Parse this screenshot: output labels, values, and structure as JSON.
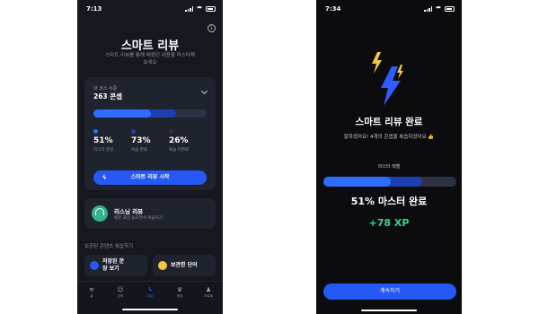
{
  "colors": {
    "accent": "#2f6cff",
    "accent_dark": "#1f3fb0",
    "success": "#3ecf8e",
    "card": "#1f232d"
  },
  "left": {
    "status_time": "7:13",
    "title": "스마트 리뷰",
    "subtitle": "스마트 리뷰를 통해 배웠던 내용을 마스터해보세요",
    "card": {
      "small_label": "내 코스 수준",
      "count": "263 콘셉",
      "progress": {
        "mastered_pct": 51,
        "reviewed_pct": 73
      },
      "stats": [
        {
          "value": "51%",
          "label": "마스터 달성",
          "color": "#2f6cff"
        },
        {
          "value": "73%",
          "label": "복습 완료",
          "color": "#1f3fb0"
        },
        {
          "value": "26%",
          "label": "복습 미완료",
          "color": "#2d3343"
        }
      ],
      "start_button": "스마트 리뷰 시작"
    },
    "listening": {
      "title": "리스닝 리뷰",
      "subtitle": "배운 표현 들으면서 복습하기"
    },
    "saved_section_label": "보관된 콘텐츠 복습하기",
    "chips": [
      {
        "label": "저장된 문장 보기"
      },
      {
        "label": "보관한 단어"
      }
    ],
    "tabs": [
      {
        "icon": "waveform-icon",
        "glyph": "≋",
        "label": "홈"
      },
      {
        "icon": "people-icon",
        "glyph": "☺",
        "label": "강좌"
      },
      {
        "icon": "bolt-icon",
        "glyph": "ϟ",
        "label": "리뷰"
      },
      {
        "icon": "trophy-icon",
        "glyph": "♛",
        "label": "랭킹"
      },
      {
        "icon": "profile-icon",
        "glyph": "♟",
        "label": "프로필"
      }
    ]
  },
  "right": {
    "status_time": "7:34",
    "title": "스마트 리뷰 완료",
    "subtitle": "잘하셨어요! 4개의 콘셉을 복습하셨어요 👍",
    "mastery_label": "마스터 레벨",
    "progress": {
      "mastered_pct": 51,
      "reviewed_pct": 74
    },
    "level_text": "51% 마스터 완료",
    "xp_text": "+78 XP",
    "continue_button": "계속하기"
  }
}
